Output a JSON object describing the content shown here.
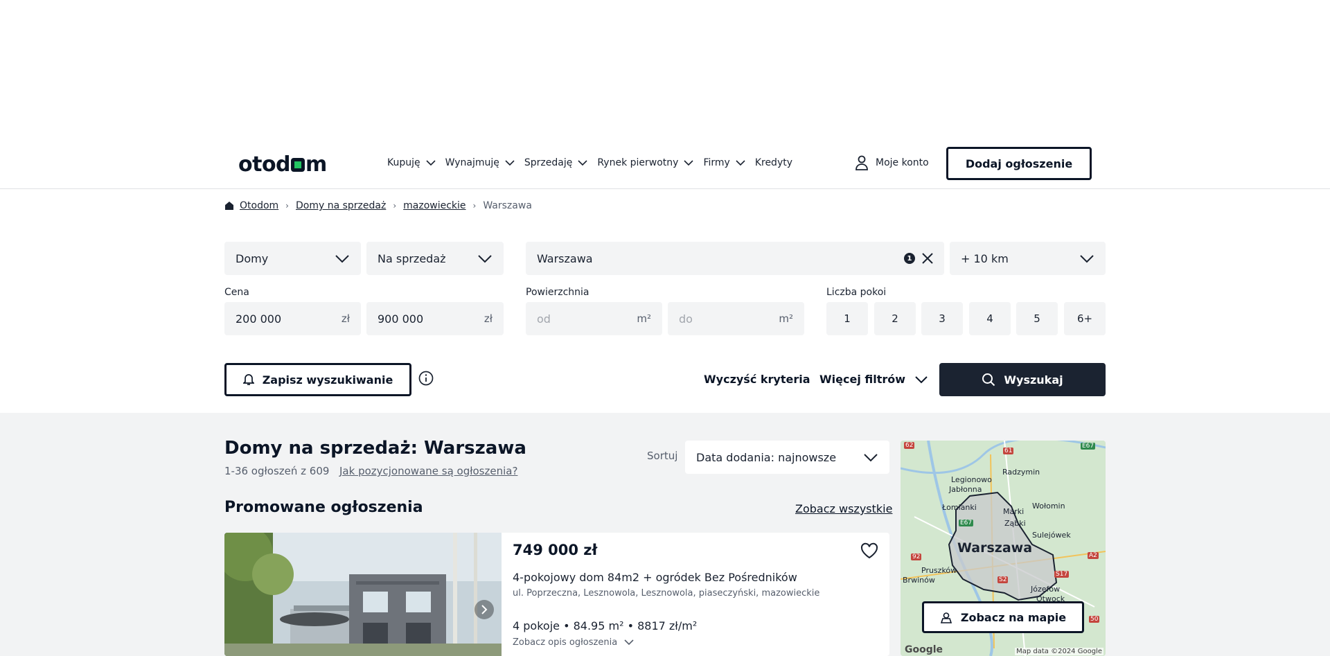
{
  "header": {
    "logo": "otodom",
    "nav": [
      {
        "label": "Kupuję",
        "has_dropdown": true
      },
      {
        "label": "Wynajmuję",
        "has_dropdown": true
      },
      {
        "label": "Sprzedaję",
        "has_dropdown": true
      },
      {
        "label": "Rynek pierwotny",
        "has_dropdown": true
      },
      {
        "label": "Firmy",
        "has_dropdown": true
      },
      {
        "label": "Kredyty",
        "has_dropdown": false
      }
    ],
    "account_label": "Moje konto",
    "add_listing_label": "Dodaj ogłoszenie"
  },
  "breadcrumb": [
    "Otodom",
    "Domy na sprzedaż",
    "mazowieckie",
    "Warszawa"
  ],
  "filters": {
    "property_type": "Domy",
    "transaction": "Na sprzedaż",
    "location": "Warszawa",
    "location_count": "1",
    "radius": "+ 10 km",
    "price_label": "Cena",
    "price_from": "200 000",
    "price_to": "900 000",
    "currency_unit": "zł",
    "area_label": "Powierzchnia",
    "area_from_placeholder": "od",
    "area_to_placeholder": "do",
    "area_unit": "m²",
    "rooms_label": "Liczba pokoi",
    "rooms": [
      "1",
      "2",
      "3",
      "4",
      "5",
      "6+"
    ],
    "save_search_label": "Zapisz wyszukiwanie",
    "clear_label": "Wyczyść kryteria",
    "more_filters_label": "Więcej filtrów",
    "search_label": "Wyszukaj"
  },
  "results": {
    "title": "Domy na sprzedaż: Warszawa",
    "count": "1-36 ogłoszeń z 609",
    "how_positioned": "Jak pozycjonowane są ogłoszenia?",
    "sort_label": "Sortuj",
    "sort_value": "Data dodania: najnowsze",
    "promoted_title": "Promowane ogłoszenia",
    "see_all": "Zobacz wszystkie"
  },
  "listing": {
    "price": "749 000 zł",
    "title": "4-pokojowy dom 84m2 + ogródek Bez Pośredników",
    "address": "ul. Poprzeczna, Lesznowola, Lesznowola, piaseczyński, mazowieckie",
    "specs": "4 pokoje • 84.95 m² • 8817 zł/m²",
    "show_description": "Zobacz opis ogłoszenia"
  },
  "map": {
    "city": "Warszawa",
    "labels": [
      "Legionowo",
      "Jabłonna",
      "Radzymin",
      "Łomianki",
      "Marki",
      "Ząbki",
      "Wołomin",
      "Sulejówek",
      "Pruszków",
      "Brwinów",
      "Józefów",
      "Otwock"
    ],
    "road_labels": [
      "62",
      "61",
      "E67",
      "E67",
      "92",
      "S2",
      "A2",
      "S17",
      "50"
    ],
    "button_label": "Zobacz na mapie",
    "google": "Google",
    "credit": "Map data ©2024 Google"
  },
  "colors": {
    "brand_dark": "#0b1526",
    "brand_green": "#23c462",
    "search_button": "#1b2331",
    "input_bg": "#f3f4f5",
    "results_bg": "#f2f3f4"
  }
}
